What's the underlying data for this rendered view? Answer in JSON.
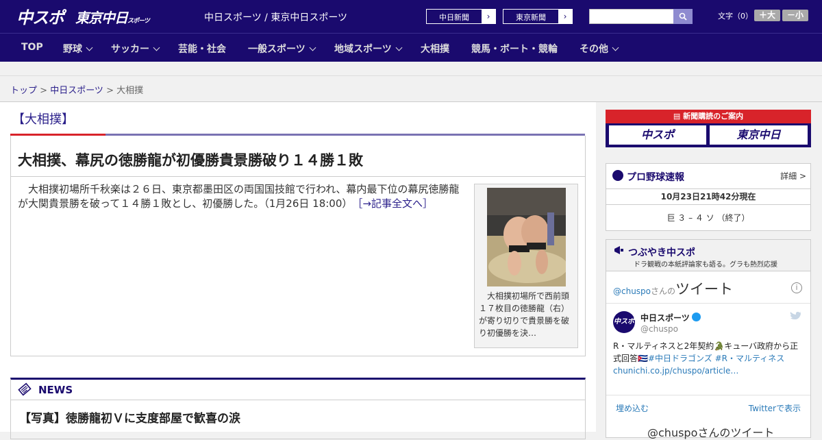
{
  "header": {
    "logo_chuspo": "中スポ",
    "logo_tokyo": "東京中日",
    "logo_tokyo_sub": "スポーツ",
    "site_title": "中日スポーツ / 東京中日スポーツ",
    "paper_buttons": [
      "中日新聞",
      "東京新聞"
    ],
    "search_placeholder": "",
    "font_size_label": "文字（0）",
    "font_up": "＋大",
    "font_down": "－小",
    "colors": {
      "brand": "#1a0a6e",
      "accent": "#d8232a"
    }
  },
  "nav": {
    "items": [
      {
        "label": "TOP",
        "has_menu": false
      },
      {
        "label": "野球",
        "has_menu": true
      },
      {
        "label": "サッカー",
        "has_menu": true
      },
      {
        "label": "芸能・社会",
        "has_menu": false
      },
      {
        "label": "一般スポーツ",
        "has_menu": true
      },
      {
        "label": "地域スポーツ",
        "has_menu": true
      },
      {
        "label": "大相撲",
        "has_menu": false
      },
      {
        "label": "競馬・ボート・競輪",
        "has_menu": false
      },
      {
        "label": "その他",
        "has_menu": true
      }
    ]
  },
  "breadcrumb": {
    "items": [
      "トップ",
      "中日スポーツ",
      "大相撲"
    ],
    "separator": " > "
  },
  "main": {
    "category_title": "【大相撲】",
    "headline": "大相撲、幕尻の徳勝龍が初優勝貴景勝破り１４勝１敗",
    "lead": "大相撲初場所千秋楽は２６日、東京都墨田区の両国国技館で行われ、幕内最下位の幕尻徳勝龍が大関貴景勝を破って１４勝１敗とし、初優勝した。（1月26日 18:00）",
    "read_more": "［→記事全文へ］",
    "photo_caption": "大相撲初場所で西前頭１７枚目の徳勝龍（右）が寄り切りで貴景勝を破り初優勝を決…",
    "news": {
      "label": "NEWS",
      "first_title": "【写真】徳勝龍初Ｖに支度部屋で歓喜の涙"
    }
  },
  "sidebar": {
    "subscription": {
      "header": "新聞購読のご案内",
      "buttons": [
        "中スポ",
        "東京中日"
      ]
    },
    "baseball": {
      "title": "プロ野球速報",
      "detail": "詳細 >",
      "time": "10月23日21時42分現在",
      "score": "巨 ３ – ４ ソ （終了）"
    },
    "tweets": {
      "title": "つぶやき中スポ",
      "subtitle": "ドラ観戦の本紙評論家も語る。グラも熱烈応援",
      "handle": "@chuspo",
      "handle_suffix": "さんの",
      "tweet_word": "ツイート",
      "account_name": "中日スポーツ",
      "account_user": "@chuspo",
      "avatar_text": "中スポ",
      "tweet_text_1": "R・マルティネスと2年契約🐊キューバ政府から正式回答🇨🇺",
      "tweet_tags": "#中日ドラゴンズ #R・マルティネス",
      "tweet_link": "chunichi.co.jp/chuspo/article…",
      "embed": "埋め込む",
      "view_on_twitter": "Twitterで表示",
      "more": "@chuspoさんのツイート"
    }
  }
}
